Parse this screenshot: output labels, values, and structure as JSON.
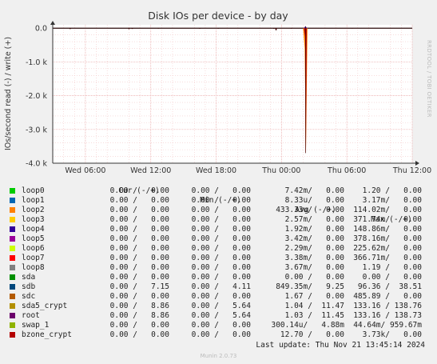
{
  "chart_data": {
    "type": "line",
    "title": "Disk IOs per device - by day",
    "ylabel": "IOs/second read (-) / write (+)",
    "ylim": [
      -4000,
      100
    ],
    "y_ticks": [
      {
        "v": 0,
        "label": "0.0"
      },
      {
        "v": -1000,
        "label": "-1.0 k"
      },
      {
        "v": -2000,
        "label": "-2.0 k"
      },
      {
        "v": -3000,
        "label": "-3.0 k"
      },
      {
        "v": -4000,
        "label": "-4.0 k"
      }
    ],
    "x_range_hours": [
      0,
      33
    ],
    "x_ticks": [
      {
        "h": 3,
        "label": "Wed 06:00"
      },
      {
        "h": 9,
        "label": "Wed 12:00"
      },
      {
        "h": 15,
        "label": "Wed 18:00"
      },
      {
        "h": 21,
        "label": "Thu 00:00"
      },
      {
        "h": 27,
        "label": "Thu 06:00"
      },
      {
        "h": 33,
        "label": "Thu 12:00"
      }
    ],
    "spike": {
      "h": 23.2,
      "read_min": -3700,
      "write_max": 60
    },
    "grid": true
  },
  "side_label": "RRDTOOL / TOBI OETIKER",
  "legend": {
    "headers": {
      "cur": "Cur (-/+)",
      "min": "Min (-/+)",
      "avg": "Avg (-/+)",
      "max": "Max (-/+)"
    },
    "rows": [
      {
        "name": "loop0",
        "color": "#00cc00",
        "cur": "0.00 /   0.00",
        "min": "0.00 /   0.00",
        "avg": "7.42m/   0.00",
        "max": "1.20 /   0.00"
      },
      {
        "name": "loop1",
        "color": "#0066b3",
        "cur": "0.00 /   0.00",
        "min": "0.00 /   0.00",
        "avg": "8.33u/   0.00",
        "max": "3.17m/   0.00"
      },
      {
        "name": "loop2",
        "color": "#ff8000",
        "cur": "0.00 /   0.00",
        "min": "0.00 /   0.00",
        "avg": "433.33u/   0.00",
        "max": "114.02m/   0.00"
      },
      {
        "name": "loop3",
        "color": "#ffcc00",
        "cur": "0.00 /   0.00",
        "min": "0.00 /   0.00",
        "avg": "2.57m/   0.00",
        "max": "371.74m/   0.00"
      },
      {
        "name": "loop4",
        "color": "#330099",
        "cur": "0.00 /   0.00",
        "min": "0.00 /   0.00",
        "avg": "1.92m/   0.00",
        "max": "148.86m/   0.00"
      },
      {
        "name": "loop5",
        "color": "#990099",
        "cur": "0.00 /   0.00",
        "min": "0.00 /   0.00",
        "avg": "3.42m/   0.00",
        "max": "378.16m/   0.00"
      },
      {
        "name": "loop6",
        "color": "#ccff00",
        "cur": "0.00 /   0.00",
        "min": "0.00 /   0.00",
        "avg": "2.29m/   0.00",
        "max": "225.62m/   0.00"
      },
      {
        "name": "loop7",
        "color": "#ff0000",
        "cur": "0.00 /   0.00",
        "min": "0.00 /   0.00",
        "avg": "3.38m/   0.00",
        "max": "366.71m/   0.00"
      },
      {
        "name": "loop8",
        "color": "#808080",
        "cur": "0.00 /   0.00",
        "min": "0.00 /   0.00",
        "avg": "3.67m/   0.00",
        "max": "1.19 /   0.00"
      },
      {
        "name": "sda",
        "color": "#008f00",
        "cur": "0.00 /   0.00",
        "min": "0.00 /   0.00",
        "avg": "0.00 /   0.00",
        "max": "0.00 /   0.00"
      },
      {
        "name": "sdb",
        "color": "#00487d",
        "cur": "0.00 /   7.15",
        "min": "0.00 /   4.11",
        "avg": "849.35m/   9.25",
        "max": "96.36 /  38.51"
      },
      {
        "name": "sdc",
        "color": "#b35a00",
        "cur": "0.00 /   0.00",
        "min": "0.00 /   0.00",
        "avg": "1.67 /   0.00",
        "max": "485.89 /   0.00"
      },
      {
        "name": "sda5_crypt",
        "color": "#b38f00",
        "cur": "0.00 /   8.86",
        "min": "0.00 /   5.64",
        "avg": "1.04 /  11.47",
        "max": "133.16 / 138.76"
      },
      {
        "name": "root",
        "color": "#6b006b",
        "cur": "0.00 /   8.86",
        "min": "0.00 /   5.64",
        "avg": "1.03 /  11.45",
        "max": "133.16 / 138.73"
      },
      {
        "name": "swap_1",
        "color": "#8fb300",
        "cur": "0.00 /   0.00",
        "min": "0.00 /   0.00",
        "avg": "300.14u/   4.88m",
        "max": "44.64m/ 959.67m"
      },
      {
        "name": "bzone_crypt",
        "color": "#b30000",
        "cur": "0.00 /   0.00",
        "min": "0.00 /   0.00",
        "avg": "12.70 /   0.00",
        "max": "3.73k/   0.00"
      }
    ]
  },
  "last_update": "Last update: Thu Nov 21 13:45:14 2024",
  "footer": "Munin 2.0.73"
}
